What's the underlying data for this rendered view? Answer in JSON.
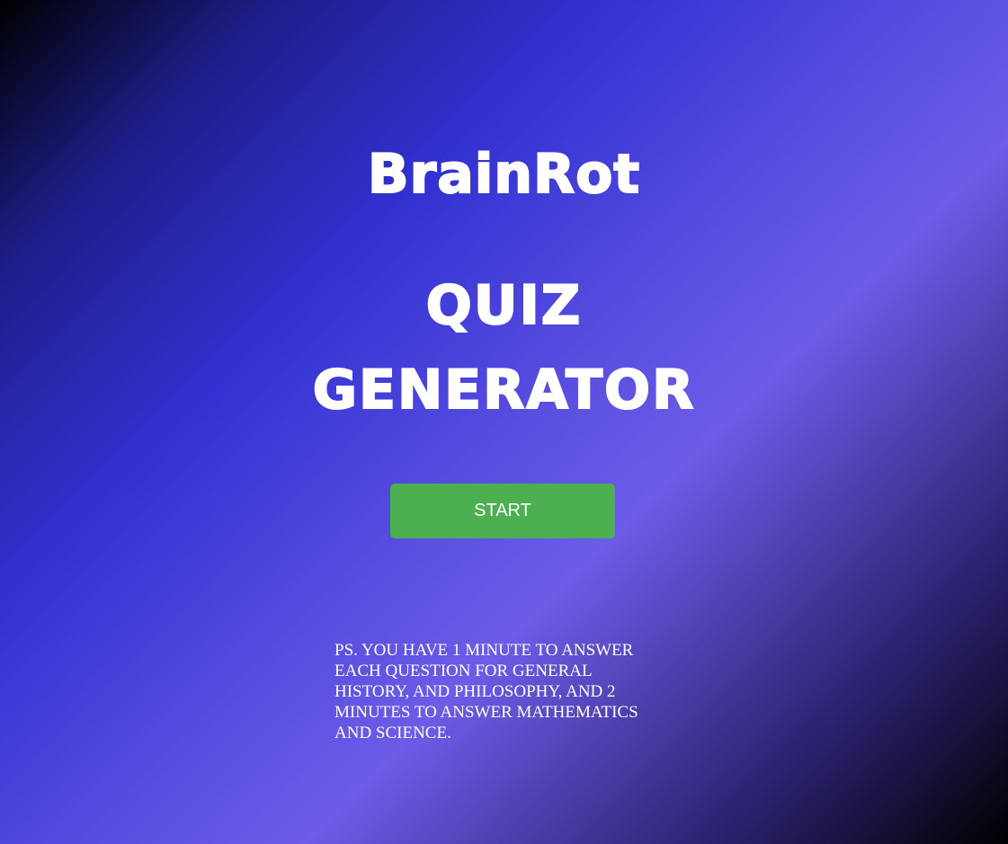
{
  "title": {
    "line1": "BrainRot",
    "line2": "QUIZ",
    "line3": "GENERATOR"
  },
  "start_button": {
    "label": "START"
  },
  "note": {
    "text": "PS. YOU HAVE 1 MINUTE TO ANSWER EACH QUESTION FOR GENERAL HISTORY, AND PHILOSOPHY, AND 2 MINUTES TO ANSWER MATHEMATICS AND SCIENCE."
  },
  "colors": {
    "button": "#4caf50",
    "text": "#ffffff",
    "gradient_mid": "#3232d2",
    "gradient_light": "#6c5ce7"
  }
}
